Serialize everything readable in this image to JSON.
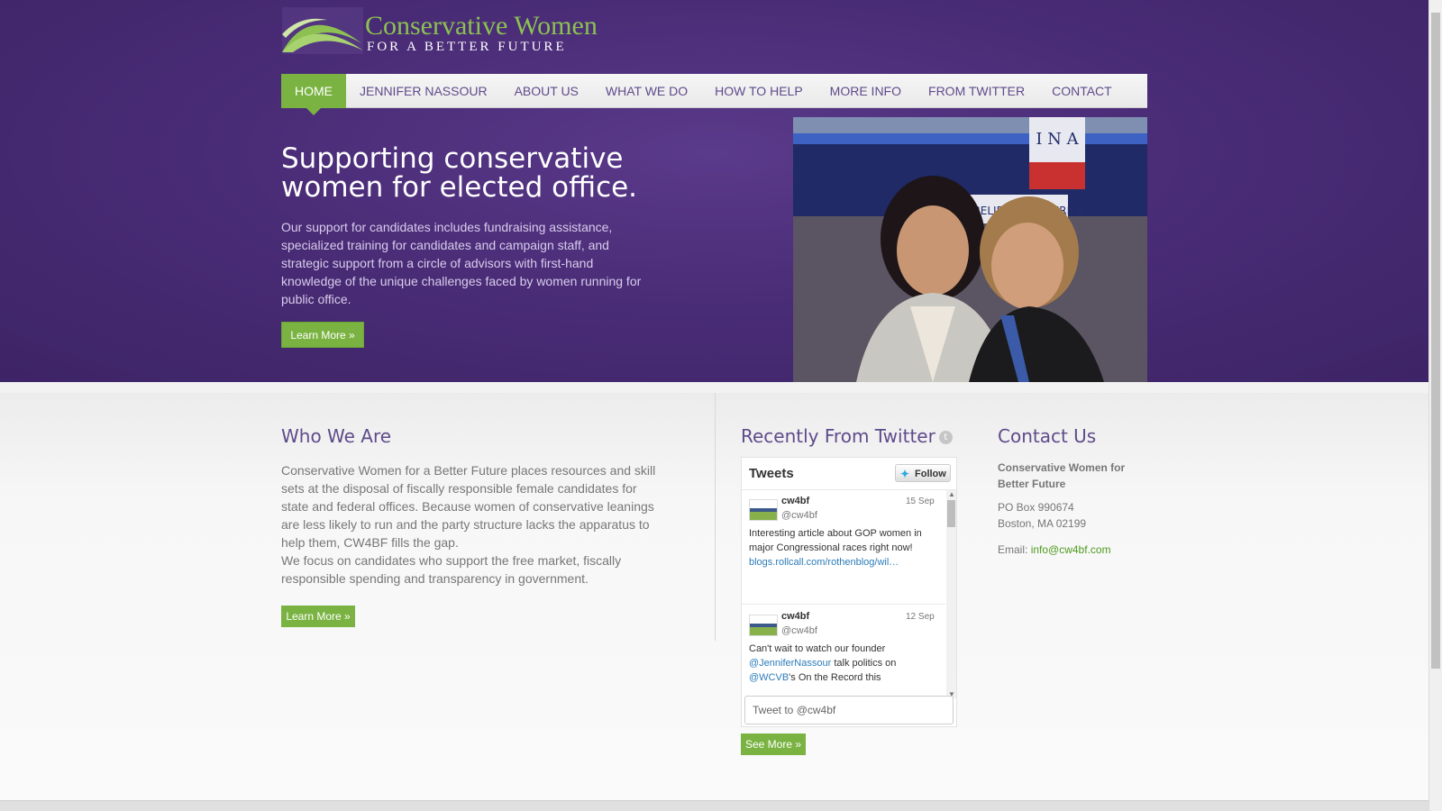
{
  "logo": {
    "title": "Conservative Women",
    "subtitle": "FOR A BETTER FUTURE"
  },
  "nav": {
    "items": [
      "HOME",
      "JENNIFER NASSOUR",
      "ABOUT US",
      "WHAT WE DO",
      "HOW TO HELP",
      "MORE INFO",
      "FROM TWITTER",
      "CONTACT"
    ],
    "active": "HOME"
  },
  "hero": {
    "title": "Supporting conservative women for elected office.",
    "text": "Our support for candidates includes fundraising assistance, specialized training for candidates and campaign staff, and strategic support from a circle of advisors with first-hand knowledge of the unique challenges faced by women running for public office.",
    "button": "Learn More »",
    "photo_sign_text": "WE BELIEVE IN AMERICA"
  },
  "who": {
    "title": "Who We Are",
    "paragraph1": "Conservative Women for a Better Future places resources and skill sets at the disposal of fiscally responsible female candidates for state and federal offices.  Because women of conservative leanings are less likely to run and the party structure lacks the apparatus to help them, CW4BF fills the gap.",
    "paragraph2": "We focus on candidates who support the free market, fiscally responsible spending and transparency in government.",
    "button": "Learn More »"
  },
  "twitter": {
    "title": "Recently From Twitter",
    "widget_title": "Tweets",
    "follow": "Follow",
    "tweets": [
      {
        "name": "cw4bf",
        "handle": "@cw4bf",
        "date": "15 Sep",
        "text": "Interesting article about GOP women in major Congressional races right now!",
        "link": "blogs.rollcall.com/rothenblog/wil…"
      },
      {
        "name": "cw4bf",
        "handle": "@cw4bf",
        "date": "12 Sep",
        "text_a": "Can't wait to watch our founder",
        "mention1": "@JenniferNassour",
        "text_b": " talk politics on",
        "mention2": "@WCVB",
        "text_c": "'s On the Record this"
      }
    ],
    "tweet_to": "Tweet to @cw4bf",
    "see_more": "See More »"
  },
  "contact": {
    "title": "Contact Us",
    "org": "Conservative Women for Better Future",
    "address1": "PO Box 990674",
    "address2": "Boston, MA 02199",
    "email_label": "Email: ",
    "email": "info@cw4bf.com"
  },
  "colors": {
    "purple": "#4a2c77",
    "green": "#7ab342",
    "heading": "#5e4b8b"
  },
  "icons": {
    "twitter": "twitter-bird-icon",
    "title_icon": "twitter-circle-icon"
  }
}
